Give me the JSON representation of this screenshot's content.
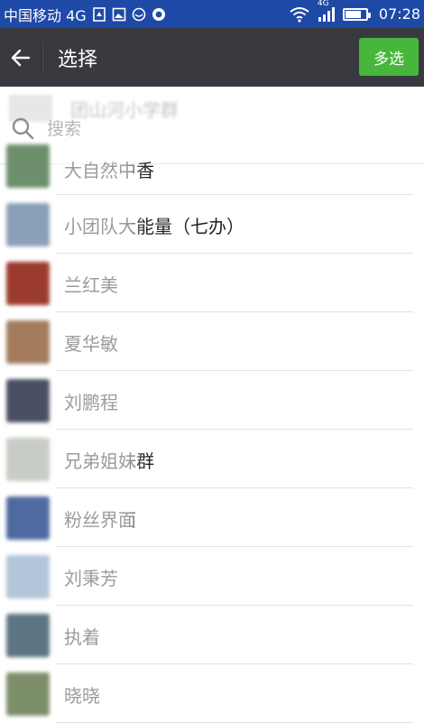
{
  "status_bar": {
    "carrier": "中国移动 4G",
    "network": "4G",
    "time": "07:28"
  },
  "app_bar": {
    "back_icon": "arrow-left-icon",
    "title": "选择",
    "multi_select_label": "多选",
    "accent_color": "#47b73c"
  },
  "search": {
    "ghost_group_name": "团山河小学群",
    "placeholder": "搜索"
  },
  "contacts": [
    {
      "name": "大自然中香",
      "avatar_color": "#6d8f6b"
    },
    {
      "name": "小团队大能量（七办）",
      "avatar_color": "#8a9fb8"
    },
    {
      "name": "兰红美",
      "avatar_color": "#9b3b2e"
    },
    {
      "name": "夏华敏",
      "avatar_color": "#a37c5e"
    },
    {
      "name": "刘鹏程",
      "avatar_color": "#4b4f63"
    },
    {
      "name": "兄弟姐妹群",
      "avatar_color": "#c8ccc6"
    },
    {
      "name": "粉丝界面",
      "avatar_color": "#4f6aa0"
    },
    {
      "name": "刘秉芳",
      "avatar_color": "#b3c6d9"
    },
    {
      "name": "执着",
      "avatar_color": "#5d7684"
    },
    {
      "name": "晓晓",
      "avatar_color": "#7d8f6a"
    }
  ]
}
